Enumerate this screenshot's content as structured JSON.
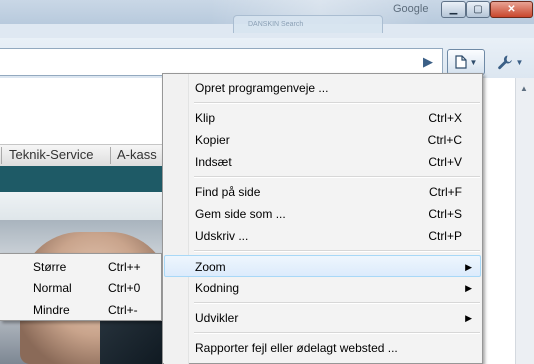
{
  "window": {
    "title": "Google",
    "background_tab": "DANSKIN Search",
    "buttons": {
      "minimize": "▁",
      "maximize": "▢",
      "close": "✕"
    }
  },
  "toolbar": {
    "go_icon": "go-arrow-icon",
    "page_menu_icon": "page-icon",
    "tools_menu_icon": "wrench-icon"
  },
  "site": {
    "nav_items": [
      "Teknik-Service",
      "A-kass"
    ],
    "colors": {
      "band": "#1e5a66"
    }
  },
  "context_menu": {
    "items": [
      {
        "label": "Opret programgenveje ...",
        "shortcut": ""
      },
      {
        "label": "Klip",
        "shortcut": "Ctrl+X"
      },
      {
        "label": "Kopier",
        "shortcut": "Ctrl+C"
      },
      {
        "label": "Indsæt",
        "shortcut": "Ctrl+V"
      },
      {
        "label": "Find på side",
        "shortcut": "Ctrl+F"
      },
      {
        "label": "Gem side som ...",
        "shortcut": "Ctrl+S"
      },
      {
        "label": "Udskriv ...",
        "shortcut": "Ctrl+P"
      },
      {
        "label": "Zoom",
        "submenu": true
      },
      {
        "label": "Kodning",
        "submenu": true
      },
      {
        "label": "Udvikler",
        "submenu": true
      },
      {
        "label": "Rapporter fejl eller ødelagt websted ...",
        "shortcut": ""
      }
    ],
    "highlighted": "Zoom",
    "submenu_arrow": "▶"
  },
  "zoom_submenu": {
    "items": [
      {
        "label": "Større",
        "shortcut": "Ctrl++"
      },
      {
        "label": "Normal",
        "shortcut": "Ctrl+0"
      },
      {
        "label": "Mindre",
        "shortcut": "Ctrl+-"
      }
    ]
  }
}
